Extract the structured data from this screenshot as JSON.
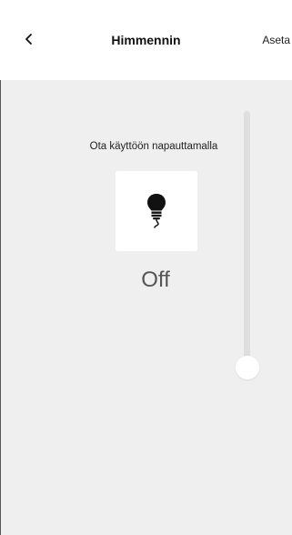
{
  "header": {
    "title": "Himmennin",
    "settings_label": "Aseta"
  },
  "device": {
    "hint": "Ota käyttöön napauttamalla",
    "state": "Off",
    "toggle_icon": "light-bulb-icon"
  },
  "dimmer": {
    "level_fraction": 0
  },
  "colors": {
    "background": "#efefef",
    "header": "#ffffff",
    "tile": "#ffffff",
    "track": "#dedede",
    "thumb": "#ffffff",
    "state_text": "#555555"
  }
}
